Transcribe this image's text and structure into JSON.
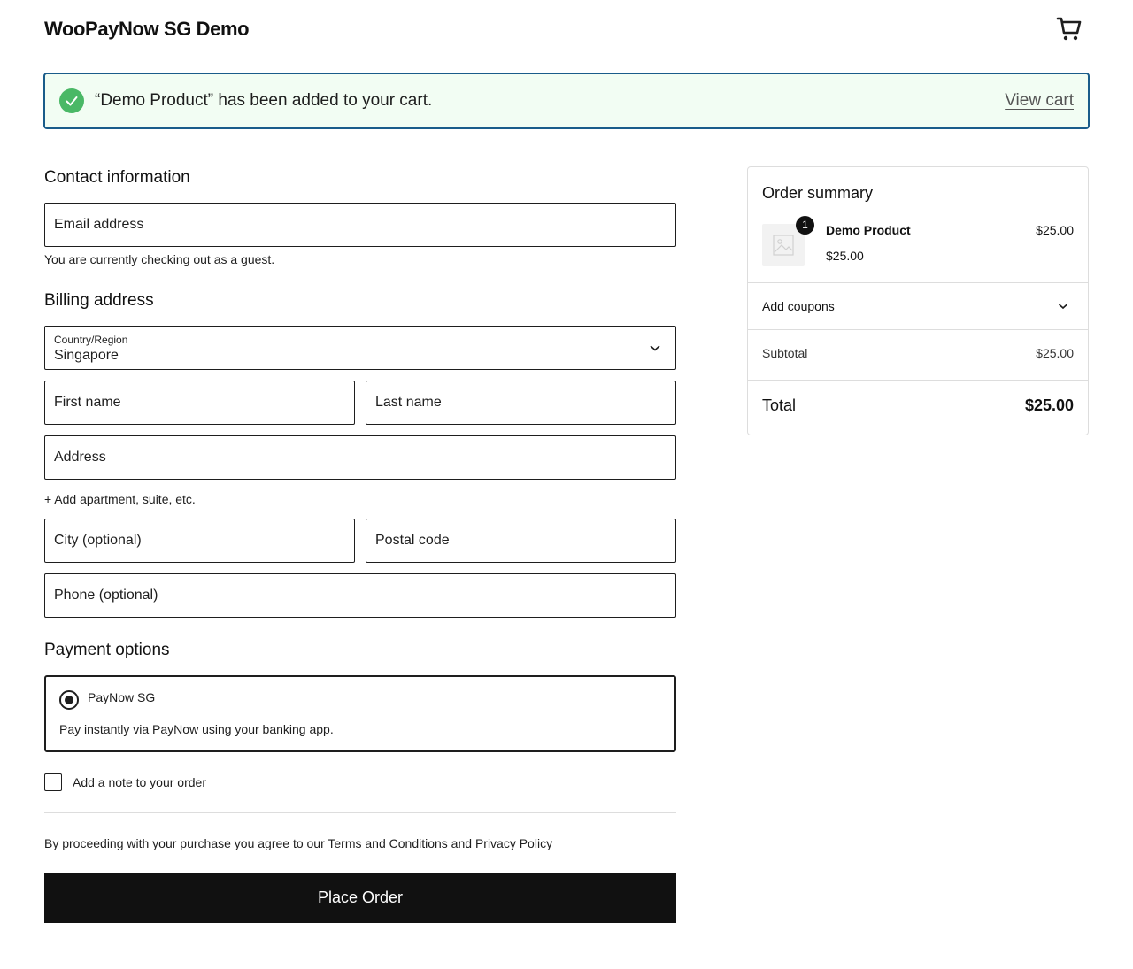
{
  "header": {
    "site_title": "WooPayNow SG Demo",
    "cart_icon": "cart-icon"
  },
  "notice": {
    "message": "“Demo Product” has been added to your cart.",
    "link": "View cart",
    "icon": "check-circle-icon",
    "color": "#4ab866"
  },
  "contact": {
    "title": "Contact information",
    "email_placeholder": "Email address",
    "guest_note": "You are currently checking out as a guest."
  },
  "billing": {
    "title": "Billing address",
    "country_label": "Country/Region",
    "country_value": "Singapore",
    "first_name": "First name",
    "last_name": "Last name",
    "address": "Address",
    "add_apartment": "+ Add apartment, suite, etc.",
    "city": "City (optional)",
    "postal_code": "Postal code",
    "phone": "Phone (optional)"
  },
  "payment": {
    "title": "Payment options",
    "method_label": "PayNow SG",
    "method_description": "Pay instantly via PayNow using your banking app.",
    "selected": true
  },
  "order_note": {
    "label": "Add a note to your order",
    "checked": false
  },
  "terms": {
    "prefix": "By proceeding with your purchase you agree to our ",
    "terms_link": "Terms and Conditions",
    "and": " and ",
    "privacy_link": "Privacy Policy"
  },
  "place_order": {
    "label": "Place Order"
  },
  "summary": {
    "title": "Order summary",
    "items": [
      {
        "name": "Demo Product",
        "quantity": "1",
        "line_total": "$25.00",
        "unit_price": "$25.00"
      }
    ],
    "coupons_label": "Add coupons",
    "subtotal_label": "Subtotal",
    "subtotal_value": "$25.00",
    "total_label": "Total",
    "total_value": "$25.00"
  }
}
